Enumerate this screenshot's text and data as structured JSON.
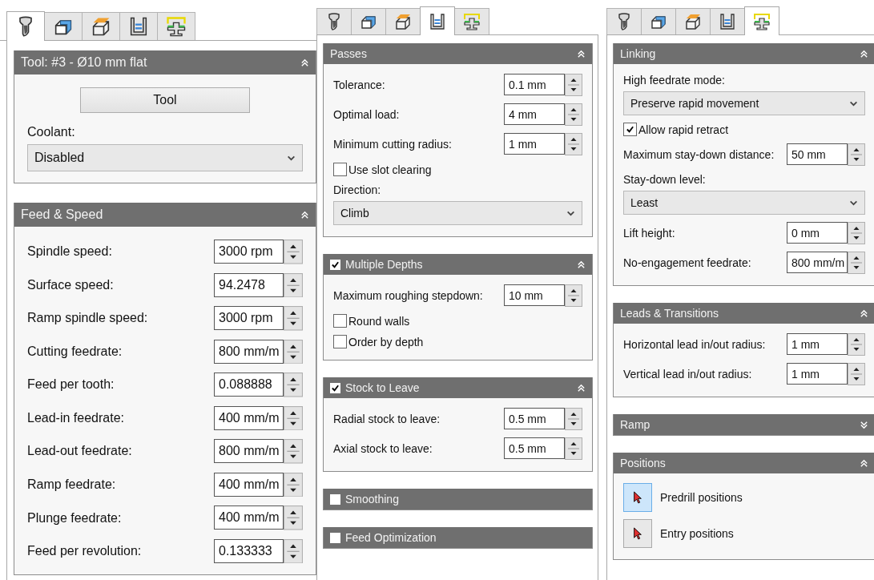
{
  "columns": [
    {
      "tabs": [
        {
          "kind": "tool",
          "selected": true
        },
        {
          "kind": "geometry",
          "selected": false
        },
        {
          "kind": "heights",
          "selected": false
        },
        {
          "kind": "passes",
          "selected": false
        },
        {
          "kind": "linking",
          "selected": false
        }
      ],
      "sections": [
        {
          "title": "Tool: #3 - Ø10 mm flat",
          "expanded": true,
          "items": [
            {
              "kind": "button",
              "label": "Tool"
            },
            {
              "kind": "select",
              "label": "Coolant:",
              "value": "Disabled"
            }
          ]
        },
        {
          "title": "Feed & Speed",
          "expanded": true,
          "items": [
            {
              "kind": "spin",
              "label": "Spindle speed:",
              "value": "3000 rpm"
            },
            {
              "kind": "spin",
              "label": "Surface speed:",
              "value": "94.2478"
            },
            {
              "kind": "spin",
              "label": "Ramp spindle speed:",
              "value": "3000 rpm"
            },
            {
              "kind": "spin",
              "label": "Cutting feedrate:",
              "value": "800 mm/m"
            },
            {
              "kind": "spin",
              "label": "Feed per tooth:",
              "value": "0.088888"
            },
            {
              "kind": "spin",
              "label": "Lead-in feedrate:",
              "value": "400 mm/m"
            },
            {
              "kind": "spin",
              "label": "Lead-out feedrate:",
              "value": "800 mm/m"
            },
            {
              "kind": "spin",
              "label": "Ramp feedrate:",
              "value": "400 mm/m"
            },
            {
              "kind": "spin",
              "label": "Plunge feedrate:",
              "value": "400 mm/m"
            },
            {
              "kind": "spin",
              "label": "Feed per revolution:",
              "value": "0.133333"
            }
          ]
        }
      ]
    },
    {
      "tabs": [
        {
          "kind": "tool",
          "selected": false
        },
        {
          "kind": "geometry",
          "selected": false
        },
        {
          "kind": "heights",
          "selected": false
        },
        {
          "kind": "passes",
          "selected": true
        },
        {
          "kind": "linking",
          "selected": false
        }
      ],
      "sections": [
        {
          "title": "Passes",
          "expanded": true,
          "items": [
            {
              "kind": "spin",
              "label": "Tolerance:",
              "value": "0.1 mm"
            },
            {
              "kind": "spin",
              "label": "Optimal load:",
              "value": "4 mm"
            },
            {
              "kind": "spin",
              "label": "Minimum cutting radius:",
              "value": "1 mm"
            },
            {
              "kind": "checkbox",
              "label": "Use slot clearing",
              "checked": false
            },
            {
              "kind": "select",
              "label": "Direction:",
              "value": "Climb"
            }
          ]
        },
        {
          "title": "Multiple Depths",
          "checked": true,
          "expanded": true,
          "items": [
            {
              "kind": "spin",
              "label": "Maximum roughing stepdown:",
              "value": "10 mm"
            },
            {
              "kind": "checkbox",
              "label": "Round walls",
              "checked": false
            },
            {
              "kind": "checkbox",
              "label": "Order by depth",
              "checked": false
            }
          ]
        },
        {
          "title": "Stock to Leave",
          "checked": true,
          "expanded": true,
          "items": [
            {
              "kind": "spin",
              "label": "Radial stock to leave:",
              "value": "0.5 mm"
            },
            {
              "kind": "spin",
              "label": "Axial stock to leave:",
              "value": "0.5 mm"
            }
          ]
        },
        {
          "title": "Smoothing",
          "checked": false
        },
        {
          "title": "Feed Optimization",
          "checked": false
        }
      ]
    },
    {
      "tabs": [
        {
          "kind": "tool",
          "selected": false
        },
        {
          "kind": "geometry",
          "selected": false
        },
        {
          "kind": "heights",
          "selected": false
        },
        {
          "kind": "passes",
          "selected": false
        },
        {
          "kind": "linking",
          "selected": true
        }
      ],
      "sections": [
        {
          "title": "Linking",
          "expanded": true,
          "items": [
            {
              "kind": "select",
              "label": "High feedrate mode:",
              "value": "Preserve rapid movement"
            },
            {
              "kind": "checkbox",
              "label": "Allow rapid retract",
              "checked": true
            },
            {
              "kind": "spin",
              "label": "Maximum stay-down distance:",
              "value": "50 mm"
            },
            {
              "kind": "select",
              "label": "Stay-down level:",
              "value": "Least"
            },
            {
              "kind": "spin",
              "label": "Lift height:",
              "value": "0 mm"
            },
            {
              "kind": "spin",
              "label": "No-engagement feedrate:",
              "value": "800 mm/m"
            }
          ]
        },
        {
          "title": "Leads & Transitions",
          "expanded": true,
          "items": [
            {
              "kind": "spin",
              "label": "Horizontal lead in/out radius:",
              "value": "1 mm"
            },
            {
              "kind": "spin",
              "label": "Vertical lead in/out radius:",
              "value": "1 mm"
            }
          ]
        },
        {
          "title": "Ramp",
          "expanded": false
        },
        {
          "title": "Positions",
          "expanded": true,
          "items": [
            {
              "kind": "pick",
              "label": "Predrill positions",
              "selected": true
            },
            {
              "kind": "pick",
              "label": "Entry positions",
              "selected": false
            }
          ]
        }
      ]
    }
  ]
}
